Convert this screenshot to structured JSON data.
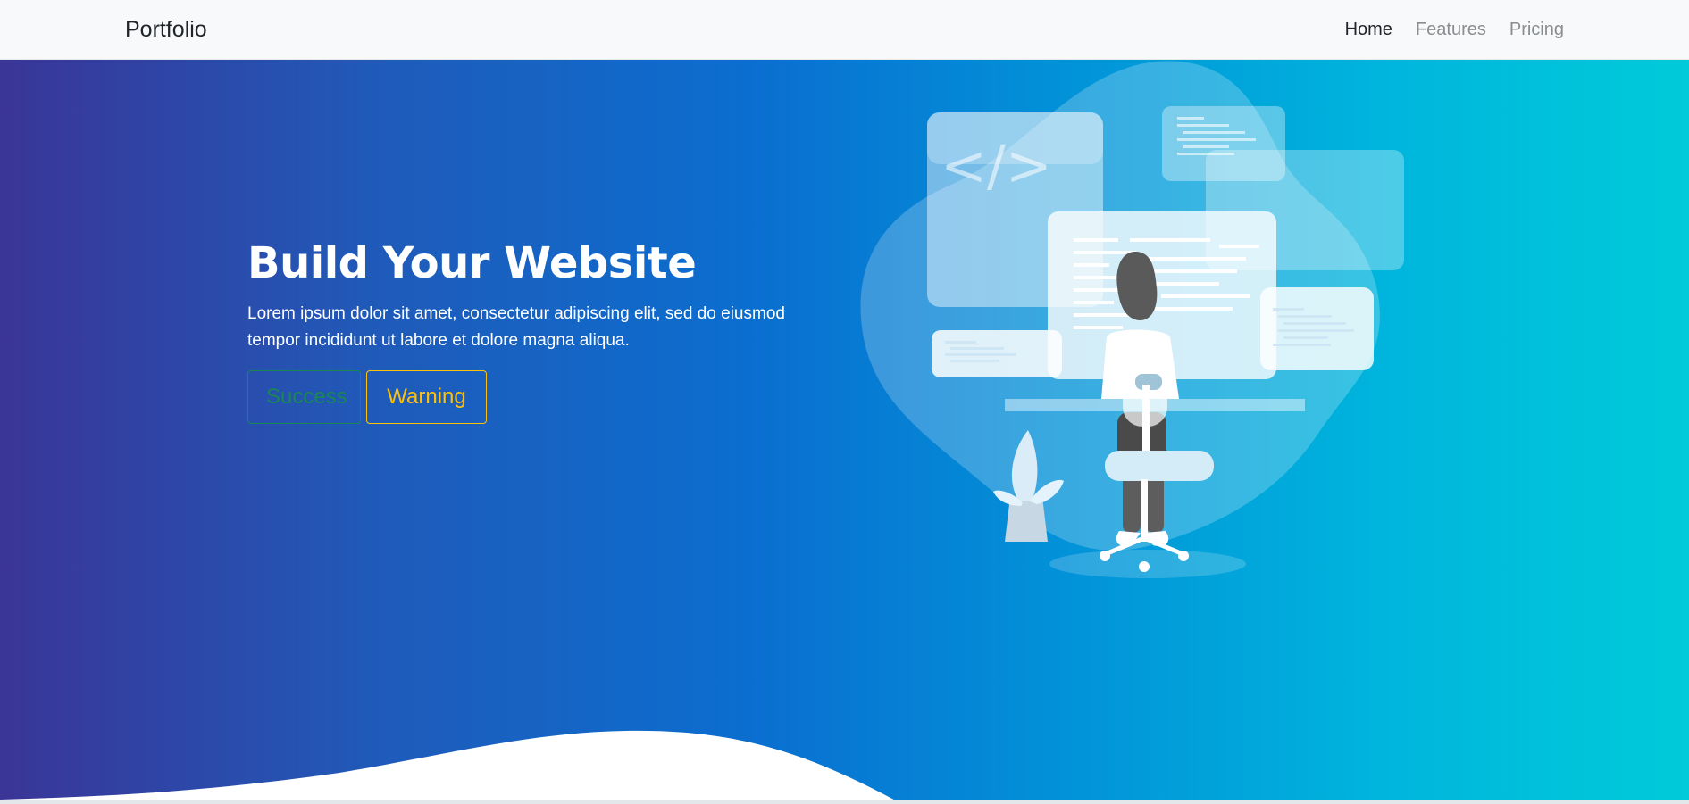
{
  "navbar": {
    "brand": "Portfolio",
    "links": [
      {
        "label": "Home",
        "active": true
      },
      {
        "label": "Features",
        "active": false
      },
      {
        "label": "Pricing",
        "active": false
      }
    ]
  },
  "hero": {
    "title": "Build Your Website",
    "text": "Lorem ipsum dolor sit amet, consectetur adipiscing elit, sed do eiusmod tempor incididunt ut labore et dolore magna aliqua.",
    "buttons": {
      "success": "Success",
      "warning": "Warning"
    },
    "illustration_icon": "developer-at-desk-illustration",
    "code_icon": "</>"
  },
  "colors": {
    "gradient_start": "#3a3597",
    "gradient_mid": "#0a6fd0",
    "gradient_end": "#00cbd9",
    "success": "#198754",
    "warning": "#ffc107",
    "navbar_bg": "#f8f9fa"
  }
}
